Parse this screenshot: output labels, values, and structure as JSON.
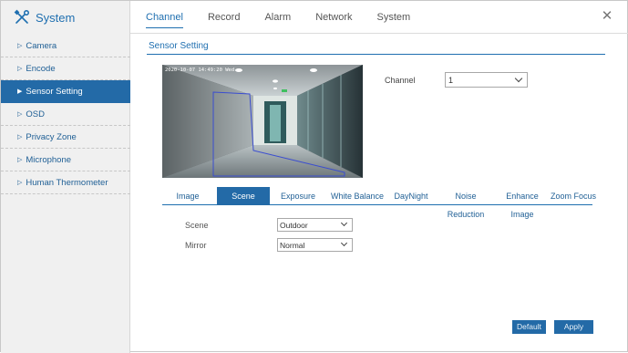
{
  "app": {
    "title": "System",
    "brand_color": "#1f6fb0",
    "accent": "#236aa7"
  },
  "top_tabs": [
    {
      "label": "Channel",
      "active": true
    },
    {
      "label": "Record"
    },
    {
      "label": "Alarm"
    },
    {
      "label": "Network"
    },
    {
      "label": "System"
    }
  ],
  "sidebar": {
    "items": [
      {
        "label": "Camera"
      },
      {
        "label": "Encode"
      },
      {
        "label": "Sensor Setting",
        "active": true
      },
      {
        "label": "OSD"
      },
      {
        "label": "Privacy Zone"
      },
      {
        "label": "Microphone"
      },
      {
        "label": "Human Thermometer"
      }
    ]
  },
  "section": {
    "title": "Sensor Setting"
  },
  "preview": {
    "timestamp": "2020-10-07 14:49:20 Wed"
  },
  "channel": {
    "label": "Channel",
    "value": "1"
  },
  "sub_tabs": [
    {
      "label": "Image"
    },
    {
      "label": "Scene",
      "active": true
    },
    {
      "label": "Exposure"
    },
    {
      "label": "White Balance"
    },
    {
      "label": "DayNight"
    },
    {
      "label": "Noise Reduction"
    },
    {
      "label": "Enhance Image"
    },
    {
      "label": "Zoom Focus"
    }
  ],
  "form": {
    "scene": {
      "label": "Scene",
      "value": "Outdoor"
    },
    "mirror": {
      "label": "Mirror",
      "value": "Normal"
    }
  },
  "buttons": {
    "default": "Default",
    "apply": "Apply"
  },
  "icons": {
    "brand": "tools-icon",
    "close": "close-icon",
    "menu_arrow": "triangle-right-icon",
    "dropdown": "chevron-down-icon"
  }
}
